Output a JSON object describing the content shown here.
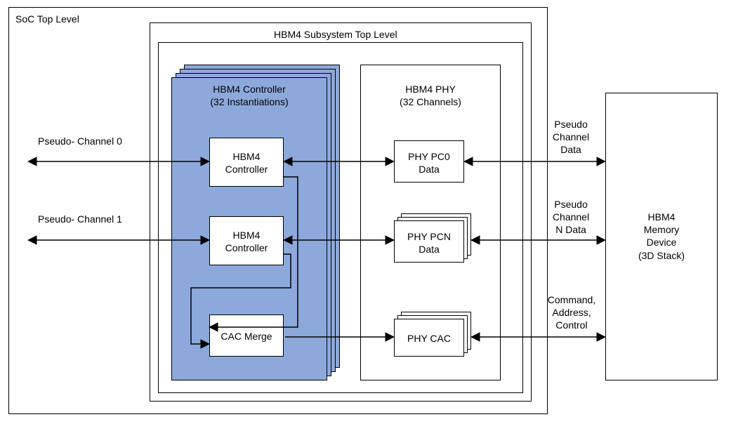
{
  "diagram": {
    "soc_top": "SoC Top Level",
    "subsystem_top": "HBM4 Subsystem Top Level",
    "controller_title_l1": "HBM4 Controller",
    "controller_title_l2": "(32 Instantiations)",
    "phy_title_l1": "HBM4 PHY",
    "phy_title_l2": "(32 Channels)",
    "controller_box_l1": "HBM4",
    "controller_box_l2": "Controller",
    "cac_merge": "CAC Merge",
    "phy_pc0_l1": "PHY PC0",
    "phy_pc0_l2": "Data",
    "phy_pcn_l1": "PHY PCN",
    "phy_pcn_l2": "Data",
    "phy_cac": "PHY CAC",
    "memory_device_l1": "HBM4",
    "memory_device_l2": "Memory",
    "memory_device_l3": "Device",
    "memory_device_l4": "(3D Stack)",
    "pseudo_ch0": "Pseudo- Channel 0",
    "pseudo_ch1": "Pseudo- Channel 1",
    "pseudo_data_l1": "Pseudo",
    "pseudo_data_l2": "Channel",
    "pseudo_data_l3": "Data",
    "pseudo_n_l1": "Pseudo",
    "pseudo_n_l2": "Channel",
    "pseudo_n_l3": "N Data",
    "cac_label_l1": "Command,",
    "cac_label_l2": "Address,",
    "cac_label_l3": "Control"
  }
}
